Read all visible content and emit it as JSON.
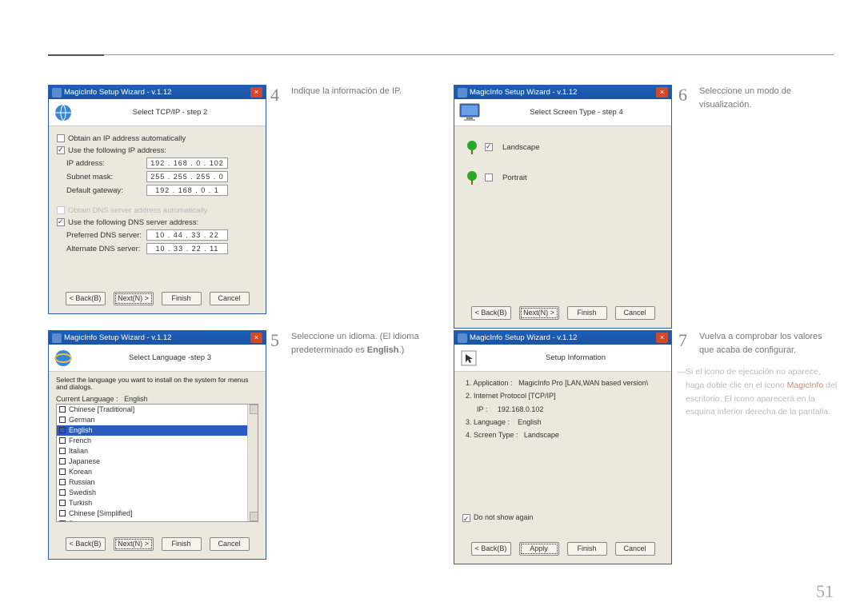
{
  "page_number": "51",
  "wizard_title": "MagicInfo Setup Wizard - v.1.12",
  "buttons": {
    "back": "< Back(B)",
    "next": "Next(N) >",
    "finish": "Finish",
    "cancel": "Cancel",
    "apply": "Apply"
  },
  "step4": {
    "num": "4",
    "text": "Indique la información de IP.",
    "header": "Select TCP/IP - step 2",
    "obtain_ip": "Obtain an IP address automatically",
    "use_ip": "Use the following IP address:",
    "ip_label": "IP address:",
    "ip_value": "192 . 168 .  0  . 102",
    "subnet_label": "Subnet mask:",
    "subnet_value": "255 . 255 . 255 .  0",
    "gateway_label": "Default gateway:",
    "gateway_value": "192 . 168 .  0  .   1",
    "obtain_dns": "Obtain DNS server address automatically",
    "use_dns": "Use the following DNS server address:",
    "pref_dns_label": "Preferred DNS server:",
    "pref_dns_value": "10 . 44 . 33 . 22",
    "alt_dns_label": "Alternate DNS server:",
    "alt_dns_value": "10 . 33 . 22 . 11"
  },
  "step5": {
    "num": "5",
    "text_a": "Seleccione un idioma. (El idioma predeterminado es ",
    "text_b": "English",
    "text_c": ".)",
    "header": "Select Language -step 3",
    "intro": "Select the language you want to install on the system for menus and dialogs.",
    "current_label": "Current Language :",
    "current_value": "English",
    "languages": [
      "Chinese [Traditional]",
      "German",
      "English",
      "French",
      "Italian",
      "Japanese",
      "Korean",
      "Russian",
      "Swedish",
      "Turkish",
      "Chinese [Simplified]",
      "Portuguese"
    ],
    "selected_index": 2
  },
  "step6": {
    "num": "6",
    "text": "Seleccione un modo de visualización.",
    "header": "Select Screen Type - step 4",
    "landscape": "Landscape",
    "portrait": "Portrait"
  },
  "step7": {
    "num": "7",
    "text": "Vuelva a comprobar los valores que acaba de configurar.",
    "header": "Setup Information",
    "l1": "1. Application :",
    "l1v": "MagicInfo Pro [LAN,WAN based version\\",
    "l2": "2. Internet Protocol [TCP/IP]",
    "l2ip_label": "IP :",
    "l2ip_value": "192.168.0.102",
    "l3": "3. Language :",
    "l3v": "English",
    "l4": "4. Screen Type :",
    "l4v": "Landscape",
    "donot": "Do not show again"
  },
  "note": {
    "a": "Si el icono de ejecución no aparece, haga doble clic en el icono ",
    "b": "MagicInfo",
    "c": " del escritorio. El icono aparecerá en la esquina inferior derecha de la pantalla."
  }
}
